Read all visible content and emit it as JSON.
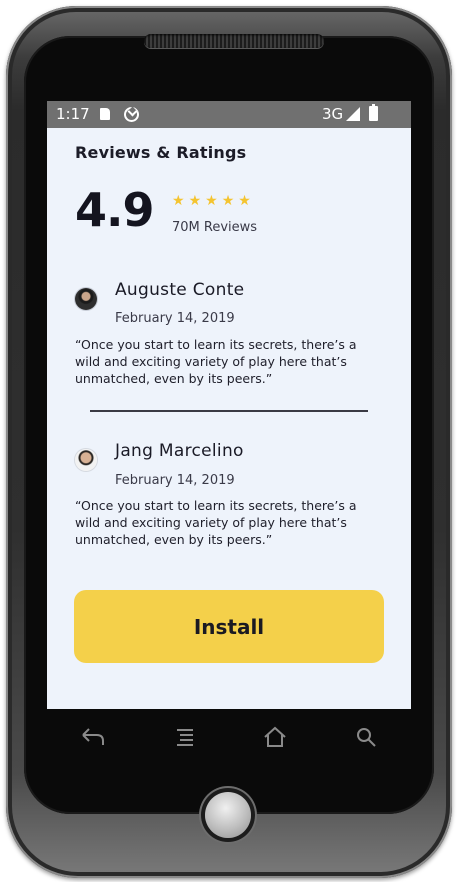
{
  "status_bar": {
    "time": "1:17",
    "network": "3G",
    "icons": [
      "sd-card-icon",
      "sync-icon",
      "signal-icon",
      "battery-icon"
    ]
  },
  "reviews_section": {
    "title": "Reviews & Ratings",
    "rating": "4.9",
    "stars": 5,
    "review_count": "70M Reviews"
  },
  "reviews": [
    {
      "name": "Auguste Conte",
      "date": "February 14, 2019",
      "text": "“Once you start to learn its secrets, there’s a wild and exciting variety of play here that’s unmatched, even by its peers.”"
    },
    {
      "name": "Jang Marcelino",
      "date": "February 14, 2019",
      "text": "“Once you start to learn its secrets, there’s a wild and exciting variety of play here that’s unmatched, even by its peers.”"
    }
  ],
  "install_button": {
    "label": "Install"
  },
  "colors": {
    "accent": "#f4d04a",
    "star": "#f4c430",
    "screen_bg": "#eef3fb",
    "status_bar": "#707070"
  },
  "nav_buttons": [
    "back-icon",
    "menu-icon",
    "home-icon",
    "search-icon"
  ]
}
